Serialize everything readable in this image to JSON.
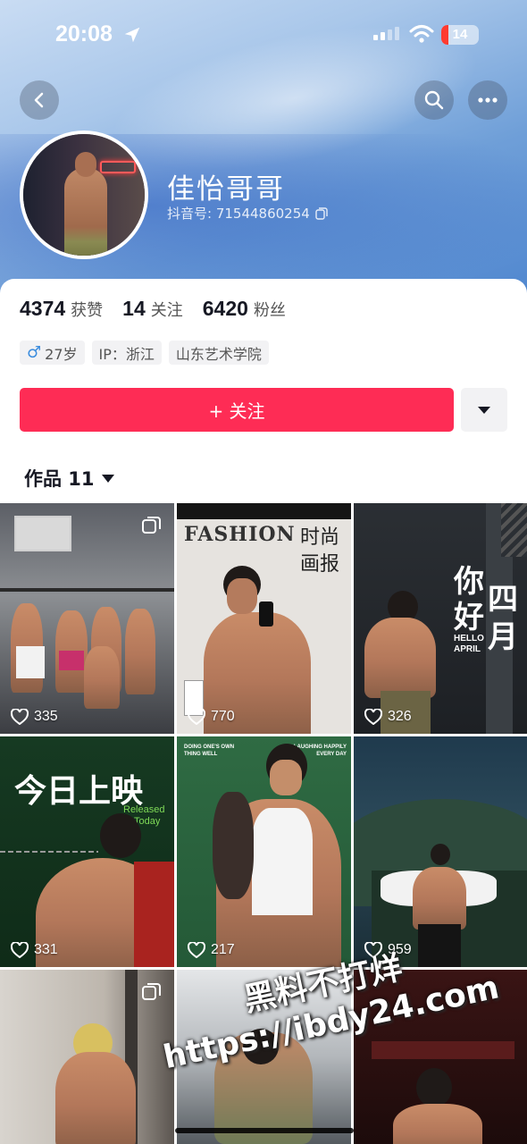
{
  "status_bar": {
    "time": "20:08",
    "battery": "14"
  },
  "profile": {
    "name": "佳怡哥哥",
    "douyin_id": "抖音号: 71544860254"
  },
  "stats": [
    {
      "num": "4374",
      "label": "获赞"
    },
    {
      "num": "14",
      "label": "关注"
    },
    {
      "num": "6420",
      "label": "粉丝"
    }
  ],
  "tags": {
    "gender_symbol": "♂",
    "age": "27岁",
    "ip": "IP：浙江",
    "school": "山东艺术学院"
  },
  "follow_button": "+ 关注",
  "works_tab": "作品 11",
  "videos": [
    {
      "likes": "335"
    },
    {
      "likes": "770",
      "title_en": "FASHION",
      "title_cn_1": "时尚",
      "title_cn_2": "画报"
    },
    {
      "likes": "326",
      "text_1": "你",
      "text_2": "好",
      "text_3": "四",
      "text_4": "月",
      "text_en_1": "HELLO",
      "text_en_2": "APRIL"
    },
    {
      "likes": "331",
      "title_cn": "今日上映",
      "text_en_1": "Released",
      "text_en_2": "Today"
    },
    {
      "likes": "217",
      "caption_left": "DOING ONE'S OWN THING WELL",
      "caption_right": "LAUGHING HAPPILY EVERY DAY"
    },
    {
      "likes": "959"
    },
    {},
    {},
    {}
  ],
  "watermark": {
    "line_1": "黑料不打烊",
    "line_2": "https://ibdy24.com"
  },
  "colors": {
    "accent": "#fe2c55",
    "text": "#161823"
  }
}
